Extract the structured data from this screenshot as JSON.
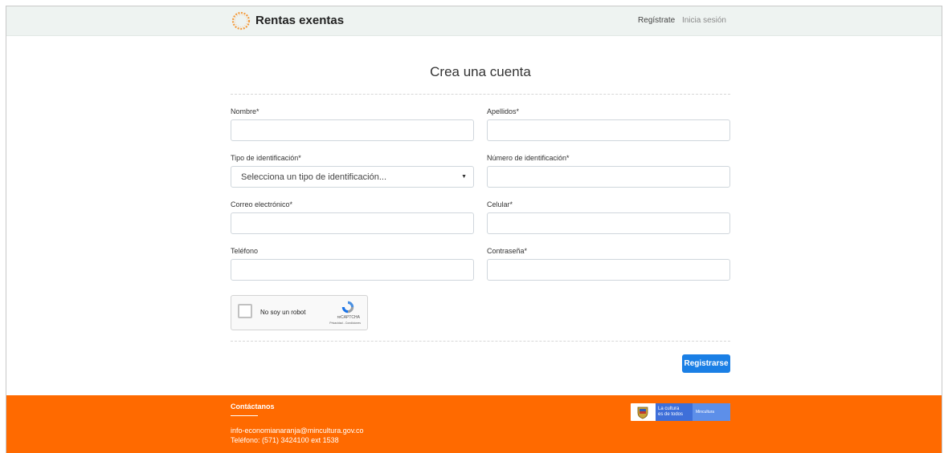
{
  "header": {
    "brand": "Rentas exentas",
    "nav_register": "Regístrate",
    "nav_login": "Inicia sesión"
  },
  "form": {
    "title": "Crea una cuenta",
    "fields": {
      "nombre": {
        "label": "Nombre*",
        "value": ""
      },
      "apellidos": {
        "label": "Apellidos*",
        "value": ""
      },
      "tipo_id": {
        "label": "Tipo de identificación*",
        "selected": "Selecciona un tipo de identificación..."
      },
      "numero_id": {
        "label": "Número de identificación*",
        "value": ""
      },
      "correo": {
        "label": "Correo electrónico*",
        "value": ""
      },
      "celular": {
        "label": "Celular*",
        "value": ""
      },
      "telefono": {
        "label": "Teléfono",
        "value": ""
      },
      "contrasena": {
        "label": "Contraseña*",
        "value": ""
      }
    },
    "captcha": {
      "label": "No soy un robot",
      "brand": "reCAPTCHA",
      "links": "Privacidad - Condiciones"
    },
    "submit_label": "Registrarse"
  },
  "footer": {
    "title": "Contáctanos",
    "email": "info-economianaranja@mincultura.gov.co",
    "phone": "Teléfono: (571) 3424100 ext 1538",
    "gov_culture_line1": "La cultura",
    "gov_culture_line2": "es de todos",
    "gov_ministry": "Mincultura"
  },
  "colors": {
    "accent": "#1a7fe5",
    "footer": "#ff6a00",
    "header": "#eef3f1"
  }
}
